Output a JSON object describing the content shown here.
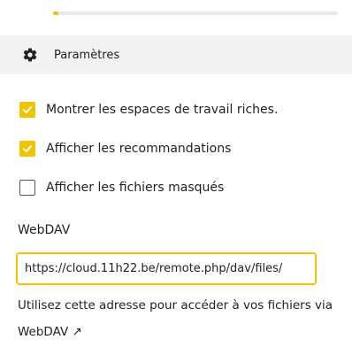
{
  "quota": {
    "used_fraction": 0.02
  },
  "settings": {
    "title": "Paramètres",
    "icon": "gear-icon"
  },
  "options": [
    {
      "label": "Montrer les espaces de travail riches.",
      "checked": true
    },
    {
      "label": "Afficher les recommandations",
      "checked": true
    },
    {
      "label": "Afficher les fichiers masqués",
      "checked": false
    }
  ],
  "webdav": {
    "label": "WebDAV",
    "url": "https://cloud.11h22.be/remote.php/dav/files/",
    "help_text": "Utilisez cette adresse pour accéder à vos ",
    "help_link": "fichiers via WebDAV ↗"
  },
  "colors": {
    "accent": "#f0c400",
    "header_bg": "#f2f2f2",
    "text": "#222222"
  }
}
